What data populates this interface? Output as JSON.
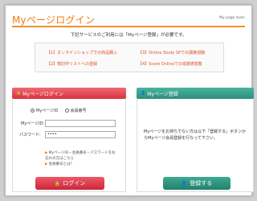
{
  "header": {
    "title": "Myページログイン",
    "subtitle": "My page main"
  },
  "intro": "下記サービスのご利用には「Myページ登録」が必要です。",
  "services": [
    "【1】オンラインショップでの商品購入",
    "【2】検討中リストへの登録",
    "【3】Online Study SPでの講義視聴",
    "【4】Score Onlineでの成績表閲覧"
  ],
  "login": {
    "heading": "Myページログイン",
    "radio_options": [
      "MyページID",
      "会員番号"
    ],
    "selected_radio": 0,
    "id_label": "MyページID:",
    "id_value": "",
    "password_label": "パスワード:",
    "password_value": "••••",
    "help_links": [
      "MyページID・会員番号・パスワードをお忘れの方はこちら",
      "会員番号とは？"
    ],
    "button_label": "ログイン"
  },
  "register": {
    "heading": "Myページ登録",
    "description": "Myページをお持ちでない方は以下「登録する」ボタンからMyページ会員登録を行なって下さい。",
    "button_label": "登録する"
  },
  "colors": {
    "accent_orange": "#ef7b12",
    "login_red": "#d8323f",
    "register_green": "#2a8f7a"
  }
}
